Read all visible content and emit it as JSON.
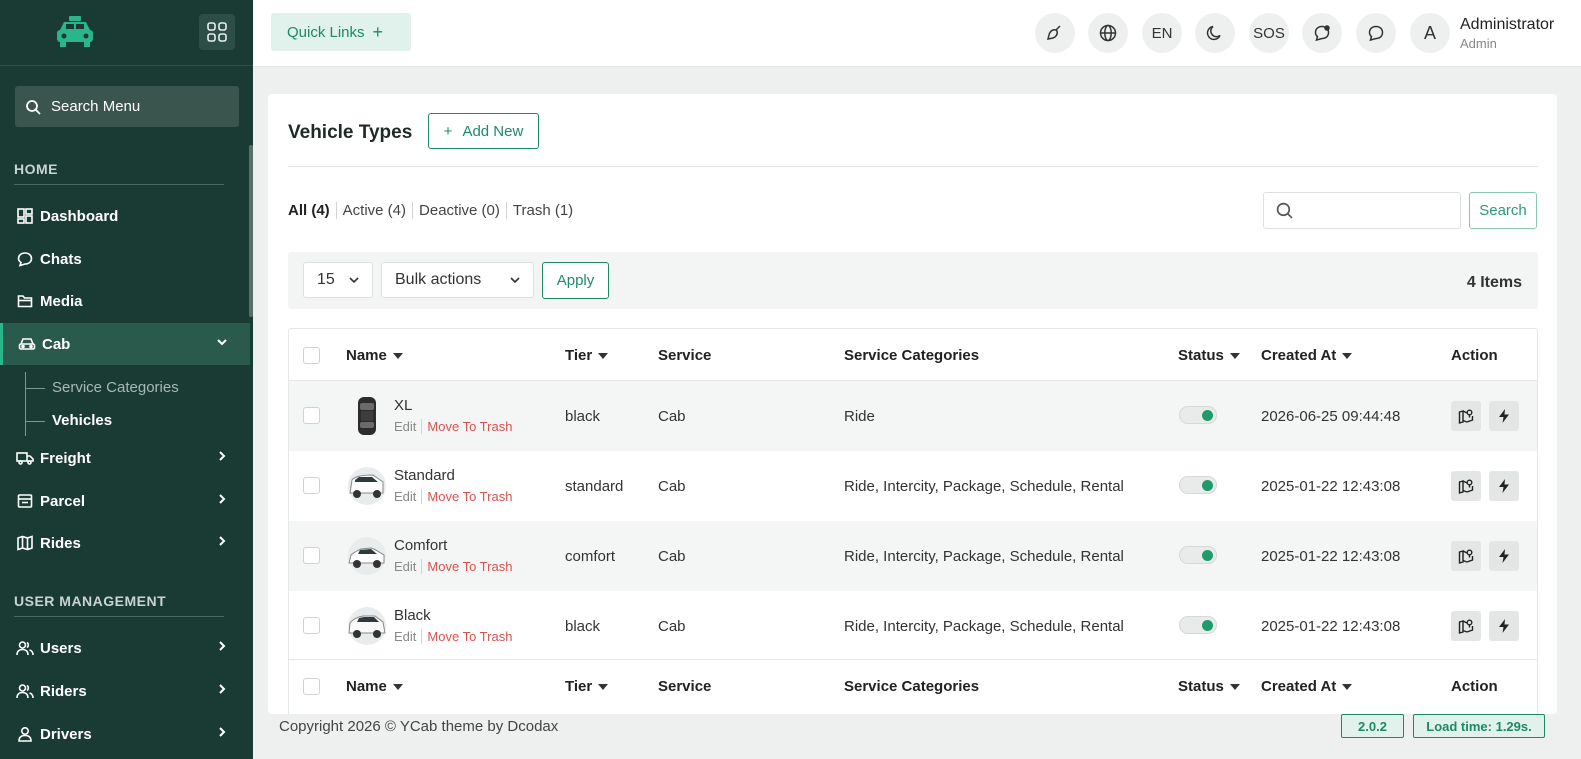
{
  "sidebar": {
    "search_placeholder": "Search Menu",
    "section_home": "HOME",
    "section_user_management": "USER MANAGEMENT",
    "items": {
      "dashboard": "Dashboard",
      "chats": "Chats",
      "media": "Media",
      "cab": "Cab",
      "freight": "Freight",
      "parcel": "Parcel",
      "rides": "Rides",
      "users": "Users",
      "riders": "Riders",
      "drivers": "Drivers"
    },
    "cab_sub": {
      "service_categories": "Service Categories",
      "vehicles": "Vehicles"
    }
  },
  "topbar": {
    "quick_links": "Quick Links",
    "language": "EN",
    "sos": "SOS",
    "avatar_letter": "A",
    "user_name": "Administrator",
    "user_role": "Admin"
  },
  "page": {
    "title": "Vehicle Types",
    "add_new": "Add New",
    "filters": {
      "all": "All (4)",
      "active": "Active (4)",
      "deactive": "Deactive (0)",
      "trash": "Trash (1)"
    },
    "search_button": "Search",
    "per_page": "15",
    "bulk_actions": "Bulk actions",
    "apply": "Apply",
    "items_count": "4 Items"
  },
  "table": {
    "headers": {
      "name": "Name",
      "tier": "Tier",
      "service": "Service",
      "service_categories": "Service Categories",
      "status": "Status",
      "created_at": "Created At",
      "action": "Action"
    },
    "row_edit": "Edit",
    "row_trash": "Move To Trash",
    "rows": [
      {
        "name": "XL",
        "tier": "black",
        "service": "Cab",
        "categories": "Ride",
        "status": "on",
        "created_at": "2026-06-25 09:44:48",
        "thumb": "suv-top-icon"
      },
      {
        "name": "Standard",
        "tier": "standard",
        "service": "Cab",
        "categories": "Ride, Intercity, Package, Schedule, Rental",
        "status": "on",
        "created_at": "2025-01-22 12:43:08",
        "thumb": "van-icon"
      },
      {
        "name": "Comfort",
        "tier": "comfort",
        "service": "Cab",
        "categories": "Ride, Intercity, Package, Schedule, Rental",
        "status": "on",
        "created_at": "2025-01-22 12:43:08",
        "thumb": "sedan-icon"
      },
      {
        "name": "Black",
        "tier": "black",
        "service": "Cab",
        "categories": "Ride, Intercity, Package, Schedule, Rental",
        "status": "on",
        "created_at": "2025-01-22 12:43:08",
        "thumb": "suv-icon"
      }
    ]
  },
  "footer": {
    "copyright": "Copyright 2026 © YCab theme by Dcodax",
    "version": "2.0.2",
    "load_time": "Load time: 1.29s."
  },
  "colors": {
    "sidebar_bg": "#1a3b33",
    "accent": "#1e8a65",
    "danger": "#d9534f",
    "logo_accent": "#2bb58a"
  }
}
